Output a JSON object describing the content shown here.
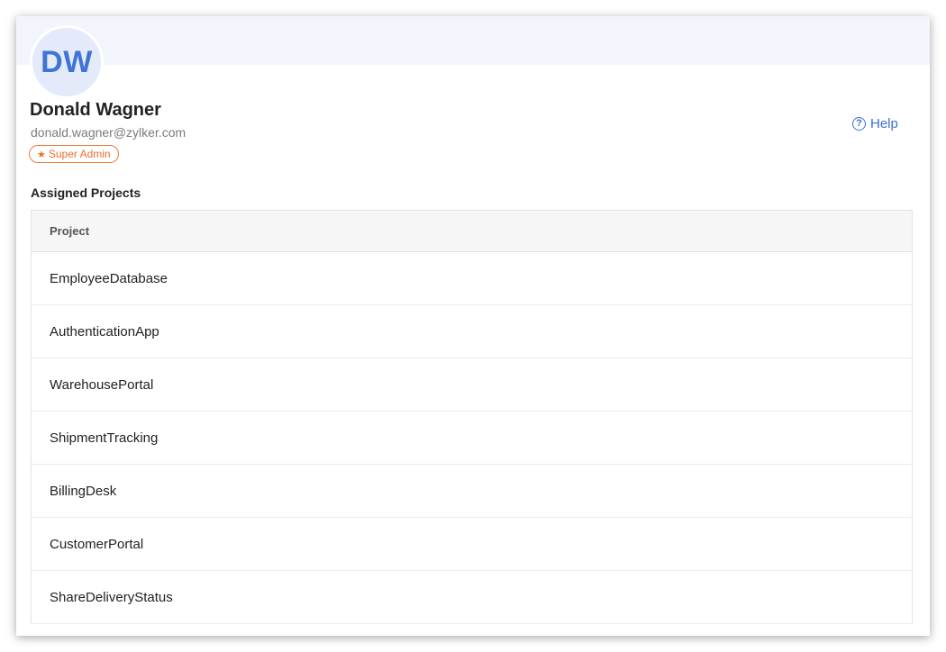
{
  "user": {
    "initials": "DW",
    "name": "Donald Wagner",
    "email": "donald.wagner@zylker.com",
    "role_star": "★",
    "role": "Super Admin"
  },
  "help": {
    "icon": "question-circle-icon",
    "label": "Help"
  },
  "projects": {
    "section_title": "Assigned Projects",
    "column_header": "Project",
    "rows": [
      "EmployeeDatabase",
      "AuthenticationApp",
      "WarehousePortal",
      "ShipmentTracking",
      "BillingDesk",
      "CustomerPortal",
      "ShareDeliveryStatus"
    ]
  },
  "colors": {
    "accent": "#3a6fd2",
    "badge": "#e8702d",
    "header_band": "#f3f5fd"
  }
}
